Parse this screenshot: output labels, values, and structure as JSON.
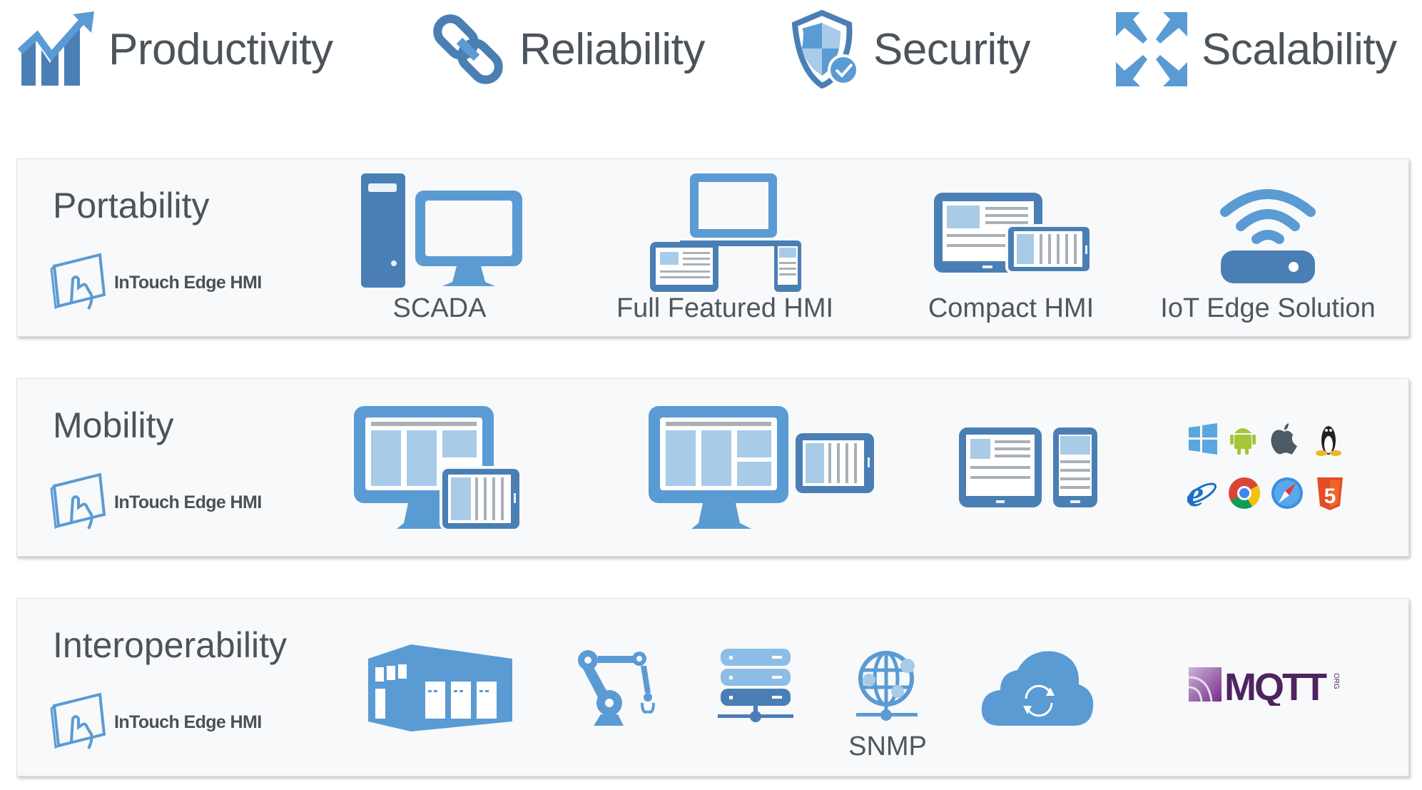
{
  "pillars": [
    {
      "label": "Productivity",
      "icon": "growth-chart-icon"
    },
    {
      "label": "Reliability",
      "icon": "chain-link-icon"
    },
    {
      "label": "Security",
      "icon": "shield-check-icon"
    },
    {
      "label": "Scalability",
      "icon": "expand-arrows-icon"
    }
  ],
  "brand_label": "InTouch Edge HMI",
  "panels": [
    {
      "title": "Portability",
      "items": [
        {
          "label": "SCADA",
          "icon": "workstation-icon"
        },
        {
          "label": "Full Featured HMI",
          "icon": "multi-device-icon"
        },
        {
          "label": "Compact HMI",
          "icon": "tablet-phone-icon"
        },
        {
          "label": "IoT Edge Solution",
          "icon": "wireless-router-icon"
        }
      ]
    },
    {
      "title": "Mobility",
      "items": [
        {
          "icon": "desktop-with-tablet-icon"
        },
        {
          "icon": "desktop-and-tablet-icon"
        },
        {
          "icon": "tablet-and-phone-icon"
        },
        {
          "icon": "platforms-grid-icon",
          "platforms": [
            "Windows",
            "Android",
            "Apple",
            "Linux",
            "Internet Explorer",
            "Chrome",
            "Safari",
            "HTML5"
          ]
        }
      ]
    },
    {
      "title": "Interoperability",
      "items": [
        {
          "icon": "factory-icon"
        },
        {
          "icon": "robot-arm-icon"
        },
        {
          "icon": "server-network-icon"
        },
        {
          "label": "SNMP",
          "icon": "globe-network-icon"
        },
        {
          "icon": "cloud-sync-icon"
        },
        {
          "label": "MQTT",
          "sub_label": "ORG",
          "icon": "mqtt-logo"
        }
      ]
    }
  ],
  "colors": {
    "primary_blue": "#5a9bd4",
    "dark_blue": "#4a7fb5",
    "light_blue": "#a8cbe8",
    "text_gray": "#4c535a",
    "panel_bg": "#f8f9fa",
    "mqtt_purple": "#5c2a6e"
  }
}
